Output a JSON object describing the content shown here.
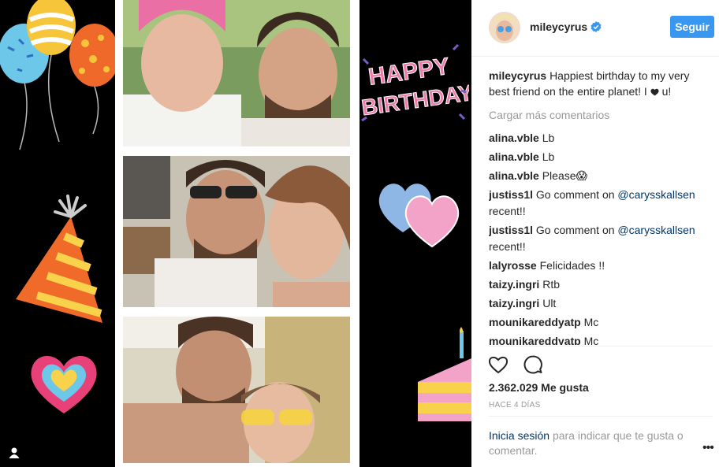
{
  "post": {
    "username": "mileycyrus",
    "follow_label": "Seguir",
    "caption_text": "Happiest birthday to my very best friend on the entire planet! I",
    "caption_suffix": "u!",
    "load_more": "Cargar más comentarios"
  },
  "comments": [
    {
      "user": "alina.vble",
      "text": "Lb"
    },
    {
      "user": "alina.vble",
      "text": "Lb"
    },
    {
      "user": "alina.vble",
      "text": "Please😱"
    },
    {
      "user": "justiss1l",
      "text": "Go comment on",
      "mention": "@carysskallsen",
      "tail": "recent!!"
    },
    {
      "user": "justiss1l",
      "text": "Go comment on",
      "mention": "@carysskallsen",
      "tail": "recent!!"
    },
    {
      "user": "lalyrosse",
      "text": "Felicidades !!"
    },
    {
      "user": "taizy.ingri",
      "text": "Rtb"
    },
    {
      "user": "taizy.ingri",
      "text": "Ult"
    },
    {
      "user": "mounikareddyatp",
      "text": "Mc"
    },
    {
      "user": "mounikareddyatp",
      "text": "Mc"
    }
  ],
  "stats": {
    "likes": "2.362.029 Me gusta",
    "time": "HACE 4 DÍAS"
  },
  "login": {
    "link": "Inicia sesión",
    "text": "para indicar que te gusta o comentar."
  },
  "media_text": {
    "happy": "HAPPY",
    "birthday": "BIRTHDAY!"
  },
  "colors": {
    "accent": "#3897f0",
    "link": "#003569",
    "muted": "#999999"
  },
  "icons": [
    "user-tag-icon",
    "verified-badge-icon",
    "like-heart-icon",
    "comment-bubble-icon",
    "more-options-icon"
  ]
}
